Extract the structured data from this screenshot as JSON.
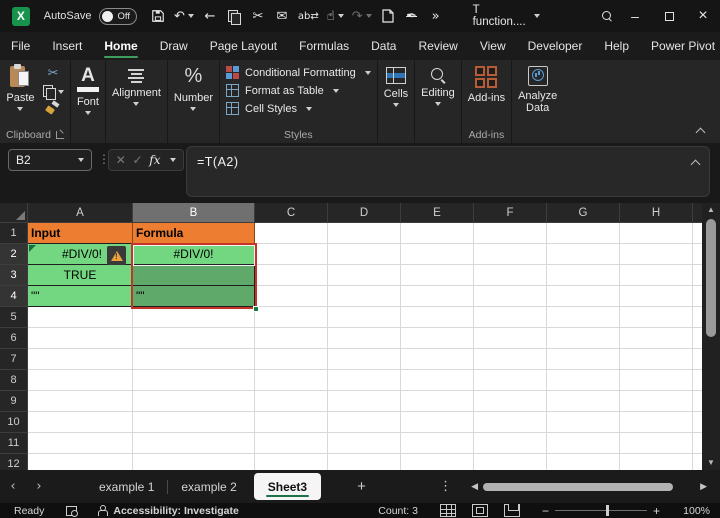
{
  "titlebar": {
    "autosave_label": "AutoSave",
    "autosave_state": "Off",
    "title": "T function....",
    "translate_glyph": "ab"
  },
  "tabs": {
    "items": [
      {
        "label": "File"
      },
      {
        "label": "Insert"
      },
      {
        "label": "Home"
      },
      {
        "label": "Draw"
      },
      {
        "label": "Page Layout"
      },
      {
        "label": "Formulas"
      },
      {
        "label": "Data"
      },
      {
        "label": "Review"
      },
      {
        "label": "View"
      },
      {
        "label": "Developer"
      },
      {
        "label": "Help"
      },
      {
        "label": "Power Pivot"
      }
    ],
    "active": "Home"
  },
  "ribbon": {
    "paste": "Paste",
    "clipboard_group": "Clipboard",
    "font": "Font",
    "alignment": "Alignment",
    "number": "Number",
    "number_glyph": "%",
    "font_glyph": "A",
    "conditional_formatting": "Conditional Formatting",
    "format_as_table": "Format as Table",
    "cell_styles": "Cell Styles",
    "styles_group": "Styles",
    "cells": "Cells",
    "editing": "Editing",
    "addins_button": "Add-ins",
    "analyze_line1": "Analyze",
    "analyze_line2": "Data",
    "addins_group": "Add-ins"
  },
  "formula_bar": {
    "name_box": "B2",
    "fx_label": "fx",
    "formula": "=T(A2)"
  },
  "grid": {
    "columns": [
      "A",
      "B",
      "C",
      "D",
      "E",
      "F",
      "G",
      "H"
    ],
    "selected_column": "B",
    "rows": [
      "1",
      "2",
      "3",
      "4",
      "5",
      "6",
      "7",
      "8",
      "9",
      "10",
      "11",
      "12"
    ],
    "selected_rows": [
      "2",
      "3",
      "4"
    ],
    "cells": {
      "A1": "Input",
      "B1": "Formula",
      "A2": "#DIV/0!",
      "B2": "#DIV/0!",
      "A3": "TRUE",
      "A4": "\"\"",
      "B4": "\"\""
    },
    "selection_range": "B2:B4"
  },
  "sheetbar": {
    "tabs": [
      {
        "label": "example 1"
      },
      {
        "label": "example 2"
      },
      {
        "label": "Sheet3"
      }
    ],
    "active": "Sheet3"
  },
  "statusbar": {
    "mode": "Ready",
    "accessibility": "Accessibility: Investigate",
    "count": "Count: 3",
    "zoom_level": "100%"
  },
  "colors": {
    "header_orange": "#ED7D31",
    "cell_green": "#73D680",
    "cell_green_selected": "#5FA96B",
    "selection_red": "#C63428",
    "accent_green": "#3F9E5F"
  }
}
